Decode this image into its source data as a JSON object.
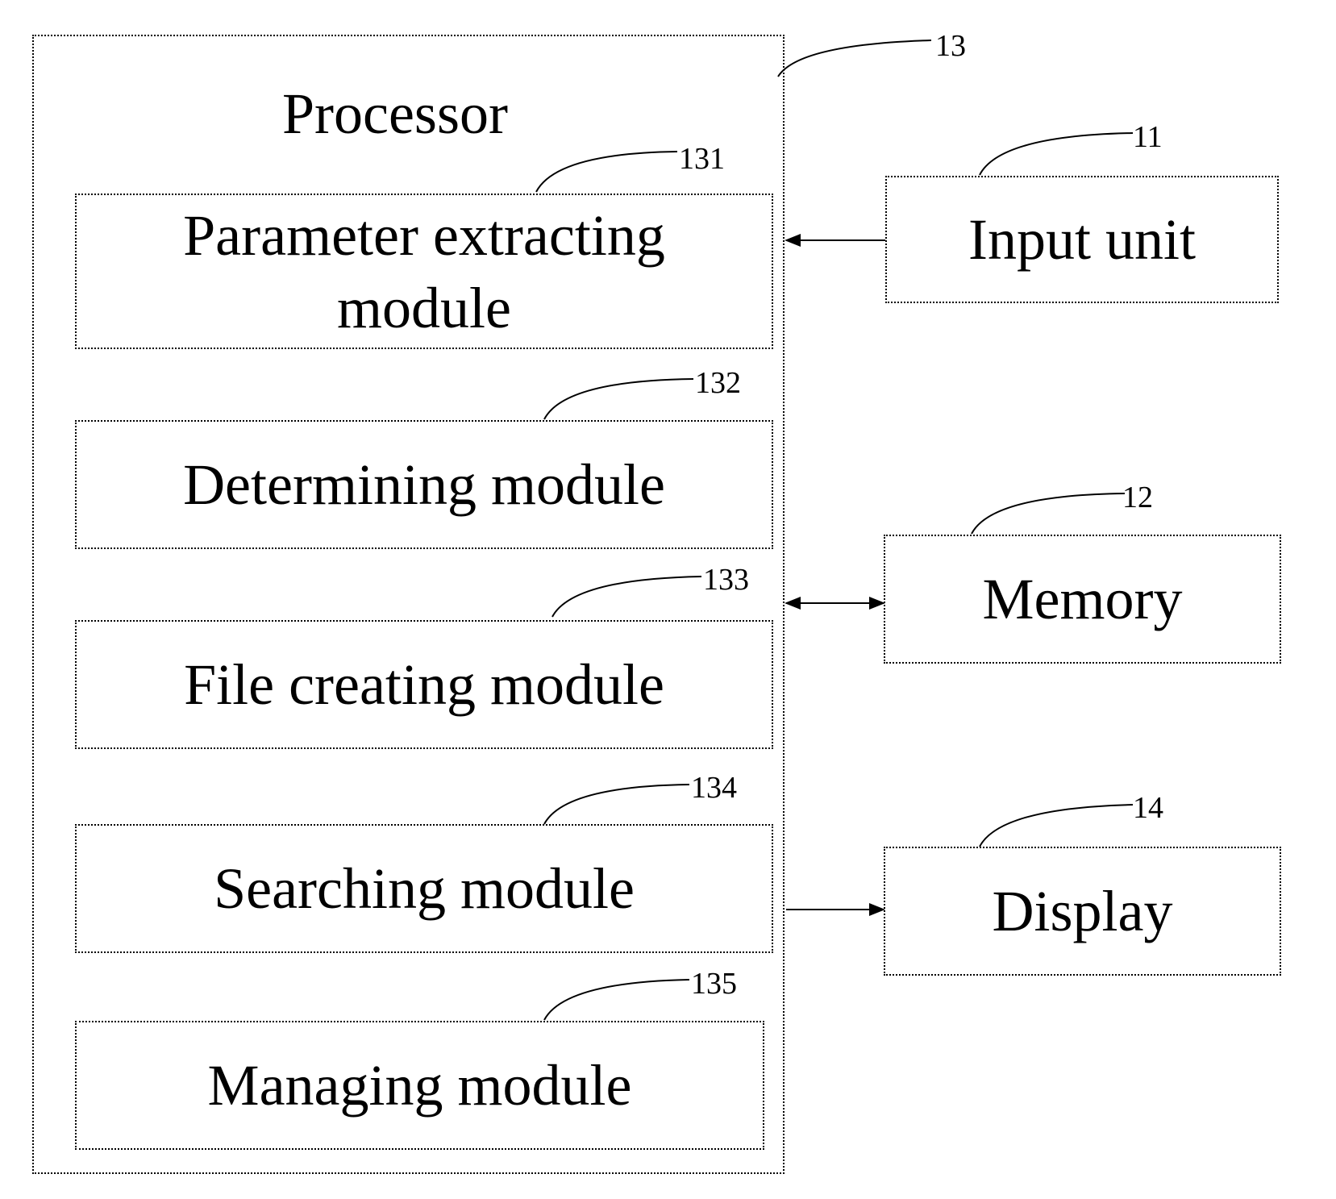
{
  "processor": {
    "title": "Processor",
    "ref": "13",
    "modules": [
      {
        "label": "Parameter extracting module",
        "ref": "131"
      },
      {
        "label": "Determining module",
        "ref": "132"
      },
      {
        "label": "File creating module",
        "ref": "133"
      },
      {
        "label": "Searching module",
        "ref": "134"
      },
      {
        "label": "Managing module",
        "ref": "135"
      }
    ]
  },
  "external": [
    {
      "label": "Input unit",
      "ref": "11",
      "connection": "to-processor"
    },
    {
      "label": "Memory",
      "ref": "12",
      "connection": "bidirectional"
    },
    {
      "label": "Display",
      "ref": "14",
      "connection": "from-processor"
    }
  ]
}
